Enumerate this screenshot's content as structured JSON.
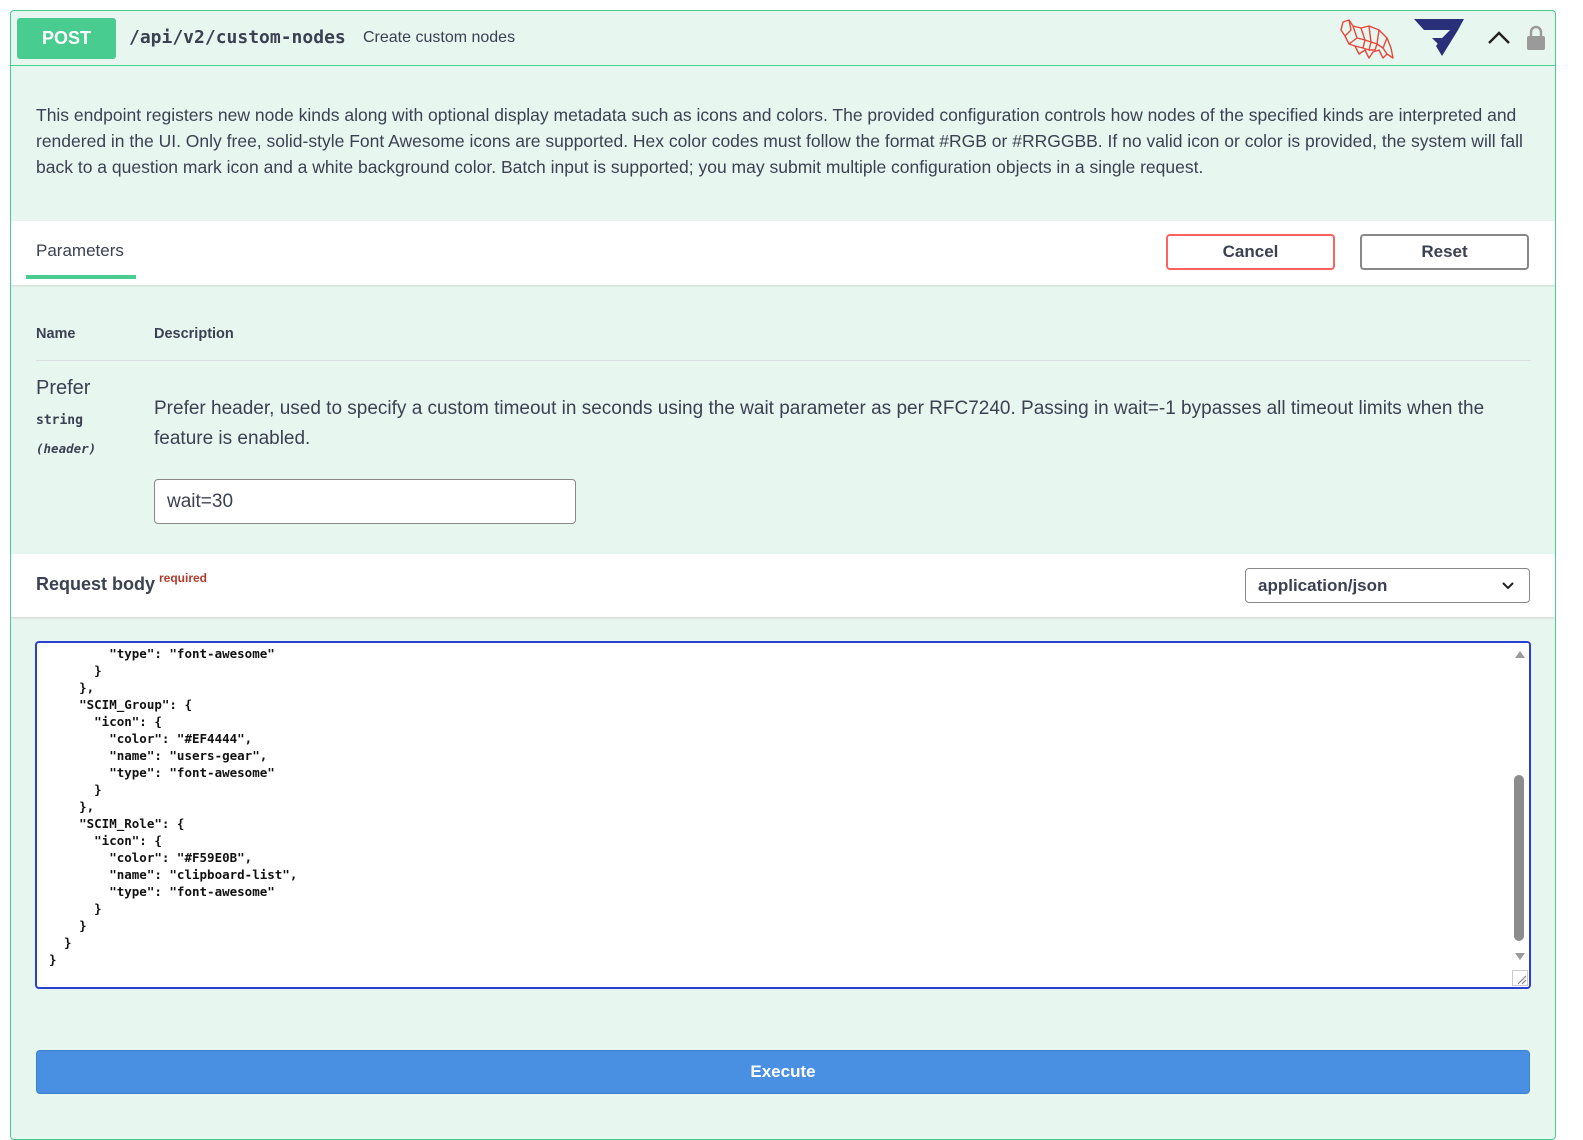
{
  "operation": {
    "method": "POST",
    "path": "/api/v2/custom-nodes",
    "summary": "Create custom nodes"
  },
  "header_icons": [
    "tiger-logo-icon",
    "shield-logo-icon",
    "chevron-up-icon",
    "lock-icon"
  ],
  "description": "This endpoint registers new node kinds along with optional display metadata such as icons and colors. The provided configuration controls how nodes of the specified kinds are interpreted and rendered in the UI. Only free, solid-style Font Awesome icons are supported. Hex color codes must follow the format #RGB or #RRGGBB. If no valid icon or color is provided, the system will fall back to a question mark icon and a white background color. Batch input is supported; you may submit multiple configuration objects in a single request.",
  "tabs": {
    "parameters_label": "Parameters",
    "cancel_label": "Cancel",
    "reset_label": "Reset"
  },
  "params_table": {
    "name_header": "Name",
    "description_header": "Description"
  },
  "parameters": [
    {
      "name": "Prefer",
      "type": "string",
      "in": "(header)",
      "description": "Prefer header, used to specify a custom timeout in seconds using the wait parameter as per RFC7240. Passing in wait=-1 bypasses all timeout limits when the feature is enabled.",
      "value": "wait=30"
    }
  ],
  "request_body": {
    "title": "Request body",
    "required_label": "required",
    "content_type": "application/json",
    "code": "        \"type\": \"font-awesome\"\n      }\n    },\n    \"SCIM_Group\": {\n      \"icon\": {\n        \"color\": \"#EF4444\",\n        \"name\": \"users-gear\",\n        \"type\": \"font-awesome\"\n      }\n    },\n    \"SCIM_Role\": {\n      \"icon\": {\n        \"color\": \"#F59E0B\",\n        \"name\": \"clipboard-list\",\n        \"type\": \"font-awesome\"\n      }\n    }\n  }\n}"
  },
  "execute_label": "Execute",
  "colors": {
    "post_green": "#49cc90",
    "block_bg": "#e8f6f0",
    "execute_blue": "#4990e2",
    "cancel_red": "#ff6060",
    "required_red": "#b03a2e",
    "editor_border": "#2a3fd1"
  }
}
